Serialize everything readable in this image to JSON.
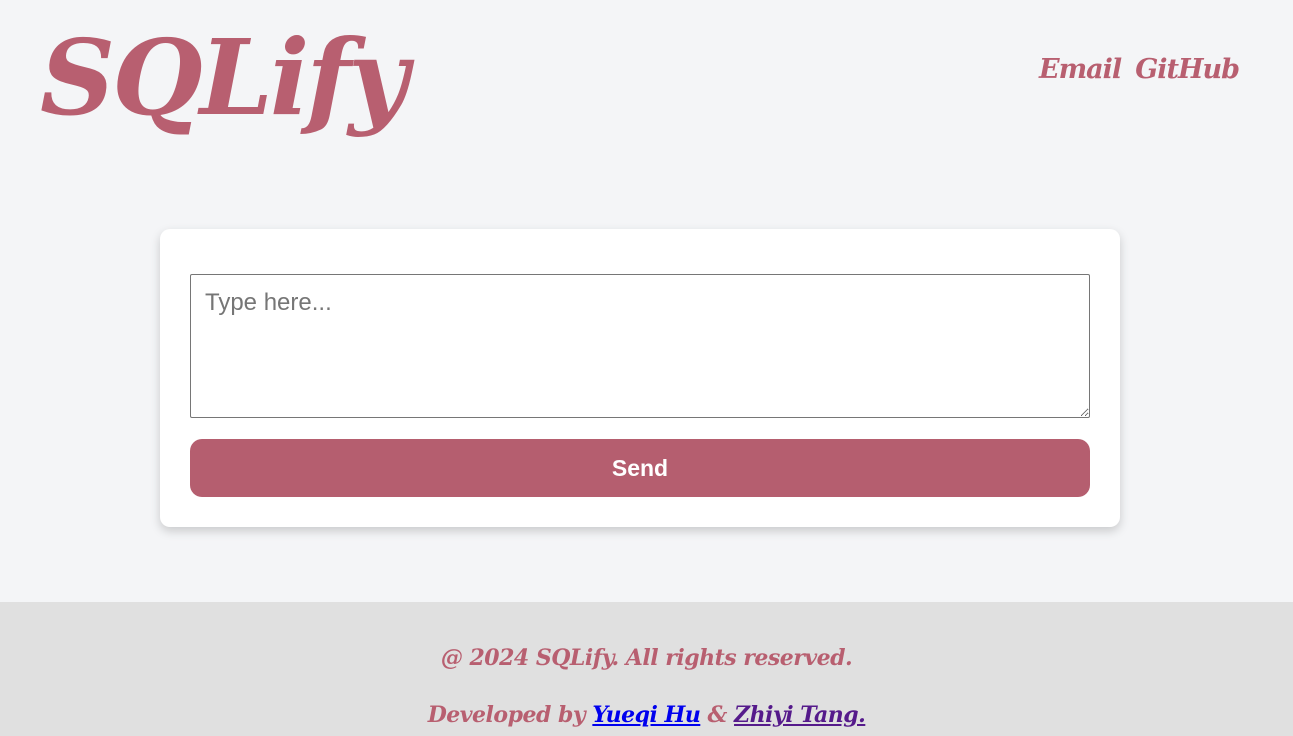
{
  "header": {
    "logo_text": "SQLify",
    "nav": {
      "email_label": "Email",
      "github_label": "GitHub"
    }
  },
  "form": {
    "input_placeholder": "Type here...",
    "input_value": "",
    "send_label": "Send"
  },
  "footer": {
    "copyright": "@ 2024 SQLify. All rights reserved.",
    "developed_by_prefix": "Developed by",
    "developer_1": "Yueqi Hu",
    "separator": "&",
    "developer_2": "Zhiyi Tang."
  },
  "colors": {
    "brand": "#b85f70",
    "send_button": "#b55e6f",
    "page_background": "#f4f5f7",
    "footer_background": "#e0e0e0",
    "link_unvisited": "#0000ee",
    "link_visited": "#551a8b"
  }
}
